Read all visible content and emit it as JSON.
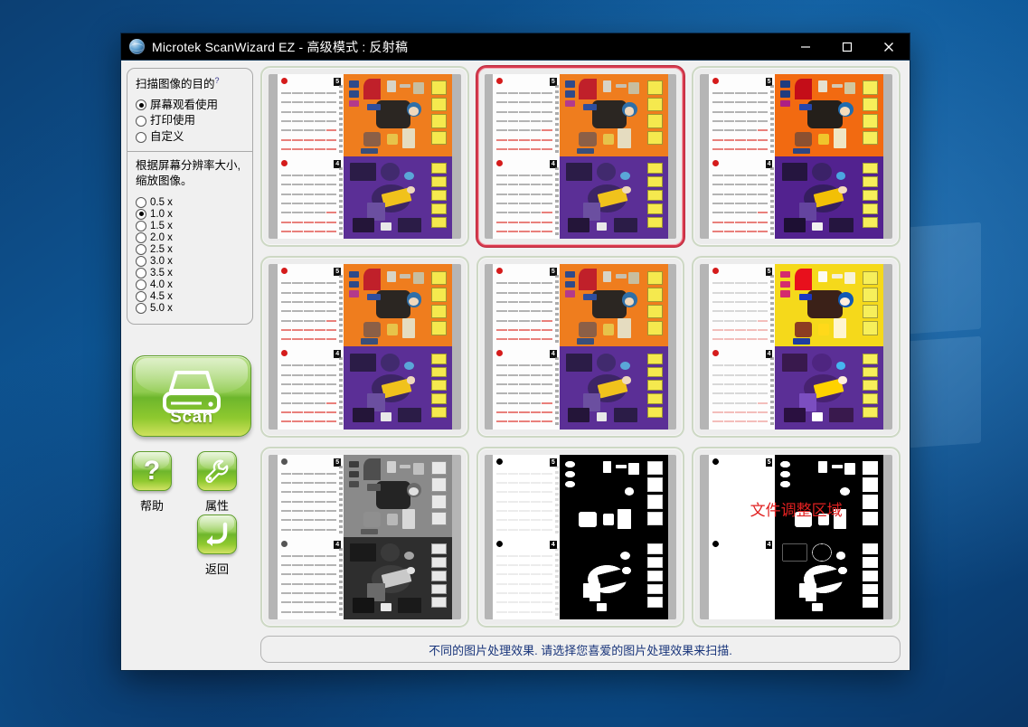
{
  "window": {
    "title": "Microtek ScanWizard EZ - 高级模式 : 反射稿",
    "icon": "globe-icon",
    "minimize_label": "–",
    "maximize_label": "□",
    "close_label": "✕"
  },
  "sidebar": {
    "purpose_panel": {
      "question": "扫描图像的目的",
      "question_mark": "?",
      "options": [
        {
          "label": "屏幕观看使用",
          "selected": true
        },
        {
          "label": "打印使用",
          "selected": false
        },
        {
          "label": "自定义",
          "selected": false
        }
      ],
      "note": "根据屏幕分辨率大小,缩放图像。",
      "scales": [
        {
          "label": "0.5 x",
          "selected": false
        },
        {
          "label": "1.0 x",
          "selected": true
        },
        {
          "label": "1.5 x",
          "selected": false
        },
        {
          "label": "2.0 x",
          "selected": false
        },
        {
          "label": "2.5 x",
          "selected": false
        },
        {
          "label": "3.0 x",
          "selected": false
        },
        {
          "label": "3.5 x",
          "selected": false
        },
        {
          "label": "4.0 x",
          "selected": false
        },
        {
          "label": "4.5 x",
          "selected": false
        },
        {
          "label": "5.0 x",
          "selected": false
        }
      ]
    },
    "scan_button": {
      "label": "Scan",
      "icon": "scanner-icon"
    },
    "tool_buttons": [
      {
        "label": "帮助",
        "icon": "question-mark-icon"
      },
      {
        "label": "属性",
        "icon": "wrench-icon"
      },
      {
        "label": "返回",
        "icon": "back-arrow-icon"
      }
    ]
  },
  "main": {
    "thumbnails": [
      {
        "id": "t1",
        "selected": false,
        "style": "color-normal",
        "top_bg": "#ef7d1e",
        "bottom_bg": "#5b2f96",
        "band": "#f5e94e",
        "overlay": ""
      },
      {
        "id": "t2",
        "selected": true,
        "style": "color-normal",
        "top_bg": "#ef7d1e",
        "bottom_bg": "#5b2f96",
        "band": "#f5e94e",
        "overlay": ""
      },
      {
        "id": "t3",
        "selected": false,
        "style": "color-saturated",
        "top_bg": "#f26a11",
        "bottom_bg": "#52228f",
        "band": "#f7ef5a",
        "overlay": ""
      },
      {
        "id": "t4",
        "selected": false,
        "style": "color-normal",
        "top_bg": "#ef7d1e",
        "bottom_bg": "#5b2f96",
        "band": "#f5e94e",
        "overlay": ""
      },
      {
        "id": "t5",
        "selected": false,
        "style": "color-normal",
        "top_bg": "#ef7d1e",
        "bottom_bg": "#5b2f96",
        "band": "#f5e94e",
        "overlay": ""
      },
      {
        "id": "t6",
        "selected": false,
        "style": "color-vivid",
        "top_bg": "#f5d91b",
        "bottom_bg": "#5b2f96",
        "band": "#f7ef5a",
        "overlay": ""
      },
      {
        "id": "t7",
        "selected": false,
        "style": "grayscale",
        "top_bg": "#8a8a8a",
        "bottom_bg": "#2e2e2e",
        "band": "#e8e8e8",
        "overlay": ""
      },
      {
        "id": "t8",
        "selected": false,
        "style": "high-contrast-gray",
        "top_bg": "#3a3a3a",
        "bottom_bg": "#0a0a0a",
        "band": "#ffffff",
        "overlay": ""
      },
      {
        "id": "t9",
        "selected": false,
        "style": "black-white",
        "top_bg": "#1a1a1a",
        "bottom_bg": "#000000",
        "band": "#ffffff",
        "overlay": "文件调整区域"
      }
    ],
    "status_text": "不同的图片处理效果. 请选择您喜爱的图片处理效果来扫描."
  },
  "colors": {
    "selected_border": "#d83a4e",
    "thumb_border": "#cdd8c4",
    "status_text": "#18347a",
    "scan_green": "#6db62c",
    "titlebar_bg": "#000000",
    "desktop_blue": "#0e5c9e"
  }
}
